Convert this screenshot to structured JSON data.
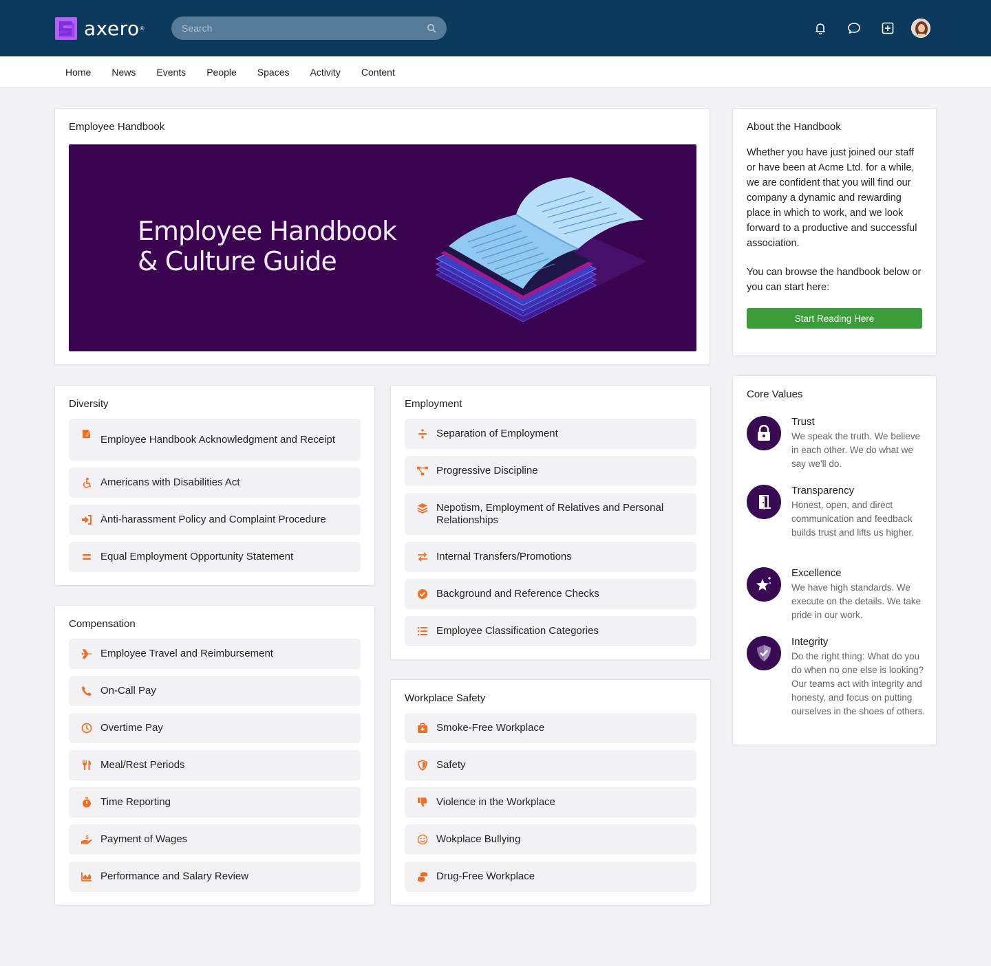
{
  "brand": {
    "name": "axero",
    "reg": "®"
  },
  "search": {
    "placeholder": "Search"
  },
  "top_icons": [
    "bell-icon",
    "chat-icon",
    "add-square-icon",
    "user-avatar"
  ],
  "nav": [
    "Home",
    "News",
    "Events",
    "People",
    "Spaces",
    "Activity",
    "Content"
  ],
  "handbook": {
    "title": "Employee Handbook",
    "banner_line1": "Employee Handbook",
    "banner_line2": "& Culture Guide"
  },
  "about": {
    "title": "About the Handbook",
    "para1": "Whether you have just joined our staff or have been at Acme Ltd. for a while, we are confident that you will find our company a dynamic and rewarding place in which to work, and we look forward to a productive and successful association.",
    "para2": "You can browse the handbook below or you can start here:",
    "button": "Start Reading Here"
  },
  "diversity": {
    "title": "Diversity",
    "items": [
      {
        "label": "Employee Handbook Acknowledgment and Receipt",
        "icon": "signature-icon"
      },
      {
        "label": "Americans with Disabilities Act",
        "icon": "accessibility-icon"
      },
      {
        "label": "Anti-harassment Policy and Complaint Procedure",
        "icon": "sign-in-icon"
      },
      {
        "label": "Equal Employment Opportunity Statement",
        "icon": "equals-icon"
      }
    ]
  },
  "employment": {
    "title": "Employment",
    "items": [
      {
        "label": "Separation of Employment",
        "icon": "divide-icon"
      },
      {
        "label": "Progressive Discipline",
        "icon": "project-diagram-icon"
      },
      {
        "label": "Nepotism, Employment of Relatives and Personal Relationships",
        "icon": "layers-icon"
      },
      {
        "label": "Internal Transfers/Promotions",
        "icon": "exchange-icon"
      },
      {
        "label": "Background and Reference Checks",
        "icon": "check-circle-icon"
      },
      {
        "label": "Employee Classification Categories",
        "icon": "list-icon"
      }
    ]
  },
  "compensation": {
    "title": "Compensation",
    "items": [
      {
        "label": "Employee Travel and Reimbursement",
        "icon": "plane-icon"
      },
      {
        "label": "On-Call Pay",
        "icon": "phone-icon"
      },
      {
        "label": "Overtime Pay",
        "icon": "clock-icon"
      },
      {
        "label": "Meal/Rest Periods",
        "icon": "utensils-icon"
      },
      {
        "label": "Time Reporting",
        "icon": "stopwatch-icon"
      },
      {
        "label": "Payment of Wages",
        "icon": "hand-holding-dollar-icon"
      },
      {
        "label": "Performance and Salary Review",
        "icon": "area-chart-icon"
      }
    ]
  },
  "safety": {
    "title": "Workplace Safety",
    "items": [
      {
        "label": "Smoke-Free Workplace",
        "icon": "first-aid-icon"
      },
      {
        "label": "Safety",
        "icon": "shield-icon"
      },
      {
        "label": "Violence in the Workplace",
        "icon": "thumbs-down-icon"
      },
      {
        "label": "Wokplace Bullying",
        "icon": "smile-icon"
      },
      {
        "label": "Drug-Free Workplace",
        "icon": "coins-icon"
      }
    ]
  },
  "core_values": {
    "title": "Core Values",
    "items": [
      {
        "name": "Trust",
        "desc": "We speak the truth. We believe in each other. We do what we say we'll do.",
        "icon": "lock-icon"
      },
      {
        "name": "Transparency",
        "desc": "Honest, open, and direct communication and feedback builds trust and lifts us higher.",
        "icon": "door-icon"
      },
      {
        "name": "Excellence",
        "desc": "We have high standards. We execute on the details. We take pride in our work.",
        "icon": "star-icon"
      },
      {
        "name": "Integrity",
        "desc": "Do the right thing: What do you do when no one else is looking? Our teams act with integrity and honesty, and focus on putting ourselves in the shoes of others.",
        "icon": "shield-check-icon"
      }
    ]
  },
  "colors": {
    "header": "#0b3a5c",
    "accent_orange": "#f26f21",
    "brand_purple": "#3a0b55",
    "button_green": "#3b9c3a"
  }
}
